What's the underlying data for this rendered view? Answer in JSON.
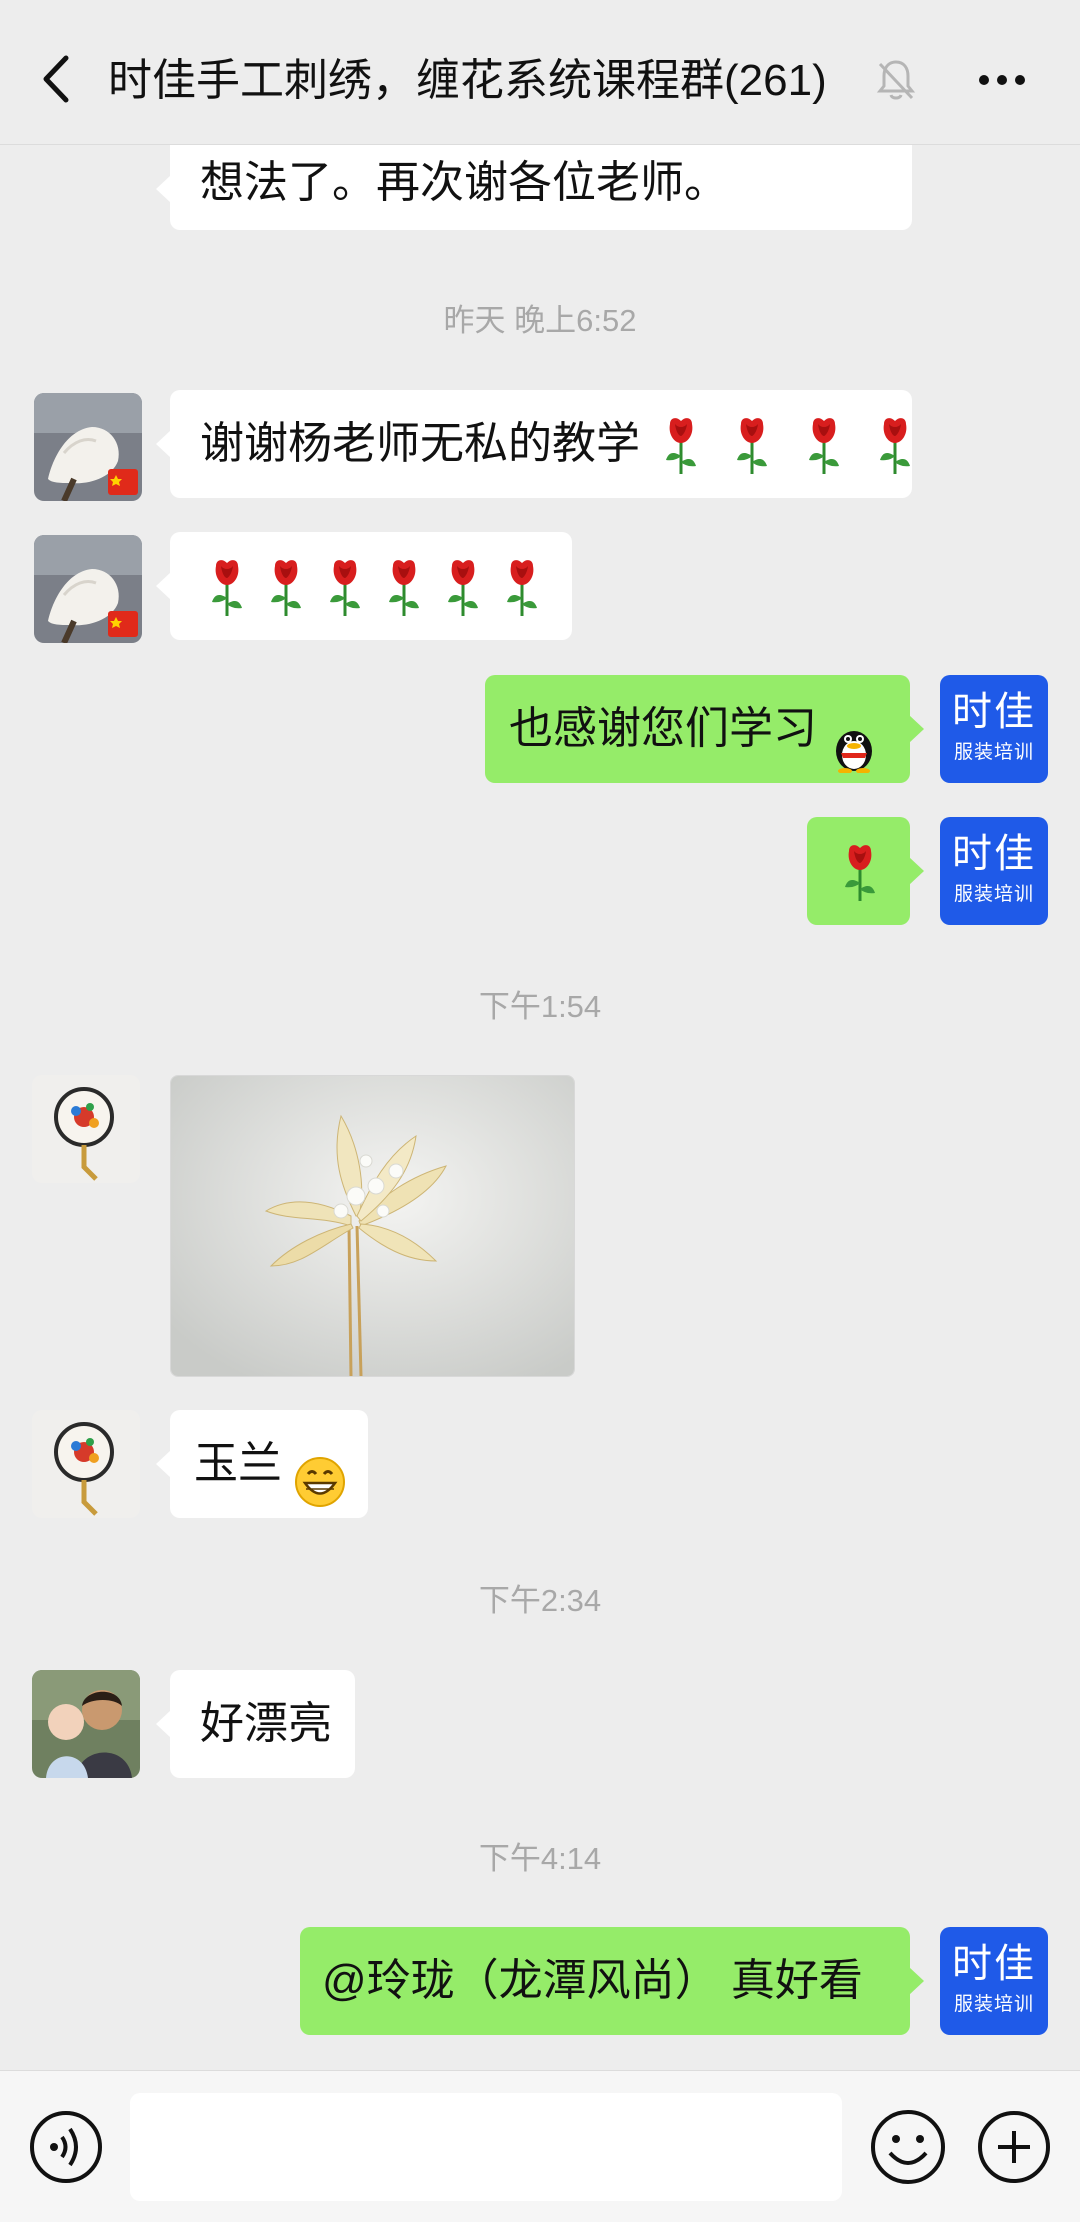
{
  "header": {
    "title": "时佳手工刺绣，缠花系统课程群(261)",
    "back_icon": "chevron-left-icon",
    "mute_icon": "bell-off-icon",
    "more_icon": "ellipsis-icon"
  },
  "messages": {
    "m0_text": "想法了。再次谢各位老师。",
    "t1": "昨天 晚上6:52",
    "m1_text": "谢谢杨老师无私的教学",
    "m3_text": "也感谢您们学习",
    "t2": "下午1:54",
    "m6_text": "玉兰",
    "t3": "下午2:34",
    "m7_text": "好漂亮",
    "t4": "下午4:14",
    "m8_text": "@玲珑（龙潭风尚） 真好看"
  },
  "self_avatar": {
    "line1": "时佳",
    "line2": "服装培训",
    "bg": "#1f5ae8"
  },
  "emoji": {
    "rose": "rose-emoji",
    "penguin": "qq-penguin-emoji",
    "grin": "grin-emoji"
  },
  "colors": {
    "background": "#ededed",
    "bubble_in": "#ffffff",
    "bubble_out": "#95ec69",
    "timestamp": "#a8a8a8"
  },
  "input_bar": {
    "voice_icon": "voice-icon",
    "emoji_icon": "emoji-icon",
    "plus_icon": "plus-icon"
  }
}
